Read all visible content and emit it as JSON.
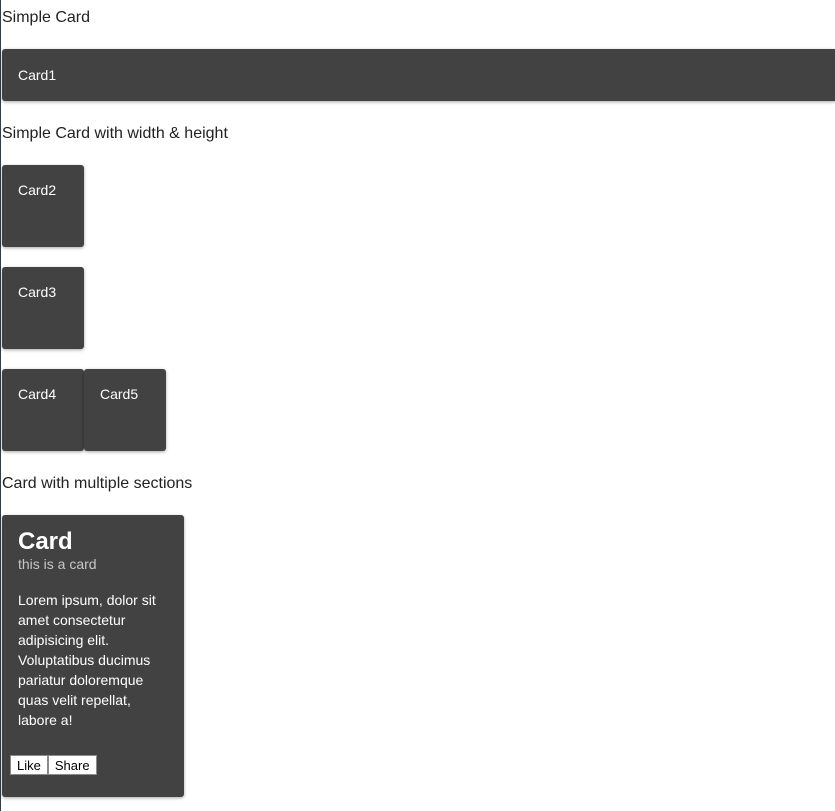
{
  "sections": {
    "simple_card": "Simple Card",
    "simple_card_wh": "Simple Card with width & height",
    "multi_section": "Card with multiple sections"
  },
  "cards": {
    "card1": "Card1",
    "card2": "Card2",
    "card3": "Card3",
    "card4": "Card4",
    "card5": "Card5"
  },
  "multi_card": {
    "title": "Card",
    "subtitle": "this is a card",
    "body": "Lorem ipsum, dolor sit amet consectetur adipisicing elit. Voluptatibus ducimus pariatur doloremque quas velit repellat, labore a!",
    "actions": {
      "like": "Like",
      "share": "Share"
    }
  },
  "colors": {
    "card_background": "#424242",
    "card_text": "#ffffff",
    "subtitle_text": "#c7c7c7",
    "page_background": "#ffffff"
  }
}
